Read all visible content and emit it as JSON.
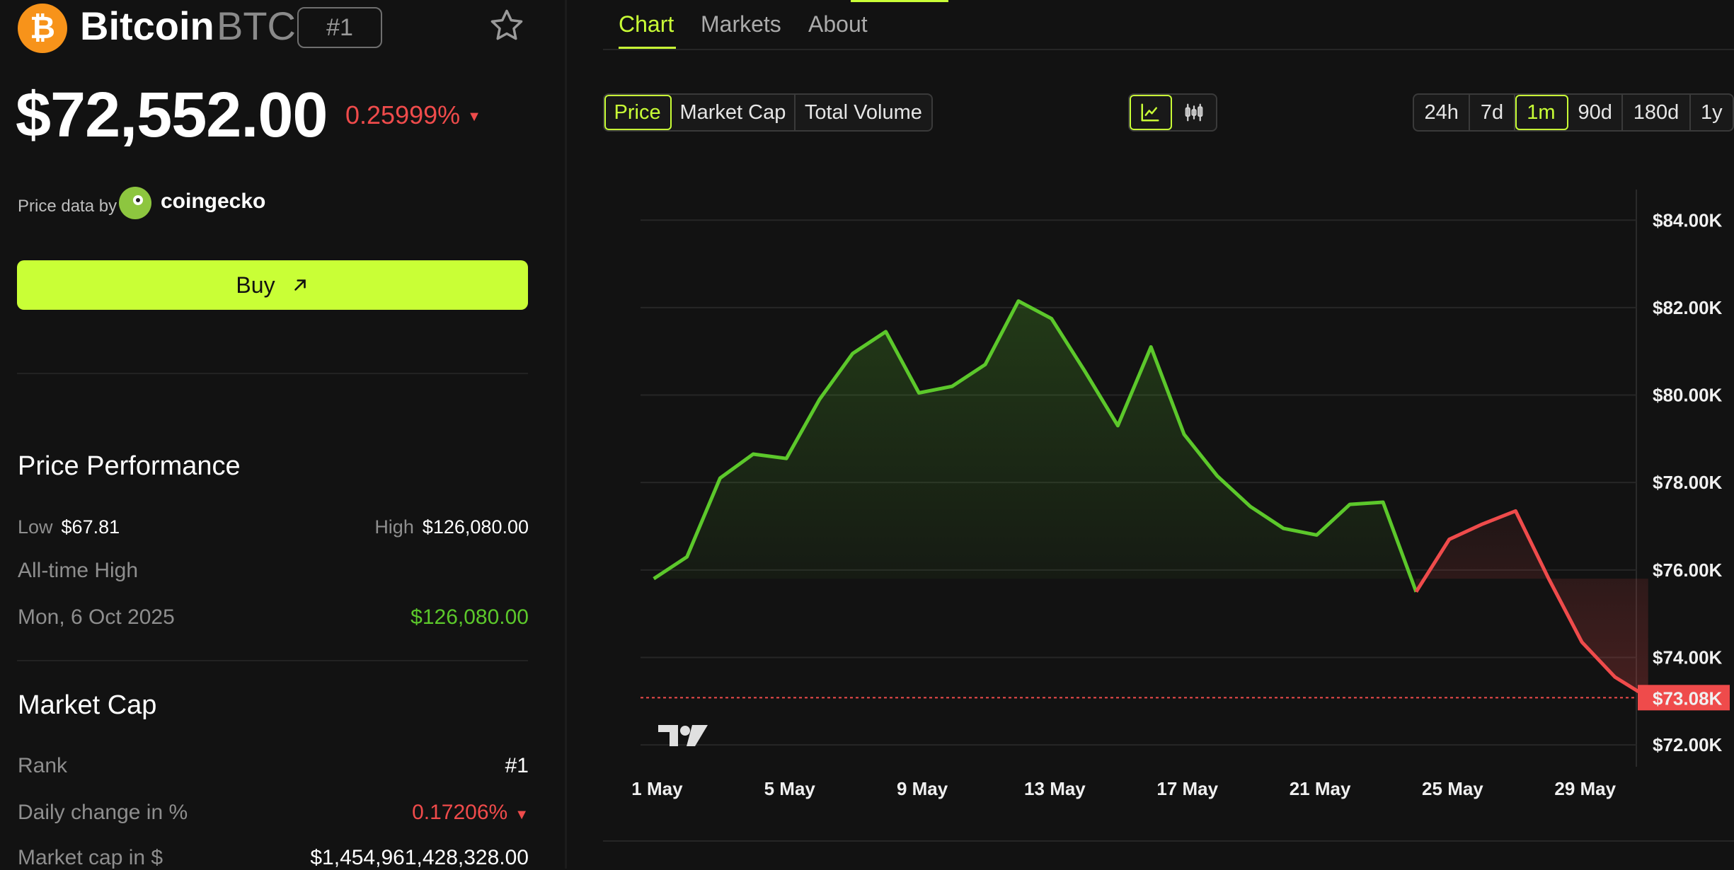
{
  "coin": {
    "logo_glyph": "₿",
    "name": "Bitcoin",
    "symbol": "BTC",
    "rank_badge": "#1",
    "price": "$72,552.00",
    "change_pct": "0.25999%",
    "change_arrow": "▼"
  },
  "source": {
    "label": "Price data by",
    "name": "coingecko"
  },
  "buy_label": "Buy",
  "performance": {
    "title": "Price Performance",
    "low_label": "Low",
    "low_value": "$67.81",
    "high_label": "High",
    "high_value": "$126,080.00",
    "ath_label": "All-time High",
    "ath_date": "Mon, 6 Oct 2025",
    "ath_value": "$126,080.00"
  },
  "market_cap": {
    "title": "Market Cap",
    "rank_label": "Rank",
    "rank_value": "#1",
    "daily_label": "Daily change in %",
    "daily_value": "0.17206%",
    "daily_arrow": "▼",
    "cap_label": "Market cap in $",
    "cap_value": "$1,454,961,428,328.00"
  },
  "tabs": [
    "Chart",
    "Markets",
    "About"
  ],
  "metric_options": [
    "Price",
    "Market Cap",
    "Total Volume"
  ],
  "range_options": [
    "24h",
    "7d",
    "1m",
    "90d",
    "180d",
    "1y"
  ],
  "colors": {
    "accent": "#c9ff36",
    "up": "#5cc82b",
    "down": "#ef4b4b",
    "bitcoin": "#f7931a"
  },
  "chart_data": {
    "type": "area",
    "ylim": [
      71500,
      84700
    ],
    "y_ticks": [
      72000,
      74000,
      76000,
      78000,
      80000,
      82000,
      84000
    ],
    "y_tick_labels": [
      "$72.00K",
      "$74.00K",
      "$76.00K",
      "$78.00K",
      "$80.00K",
      "$82.00K",
      "$84.00K"
    ],
    "x_tick_labels": [
      "1 May",
      "5 May",
      "9 May",
      "13 May",
      "17 May",
      "21 May",
      "25 May",
      "29 May"
    ],
    "x_tick_days": [
      1,
      5,
      9,
      13,
      17,
      21,
      25,
      29
    ],
    "x_range": [
      0.5,
      30.5
    ],
    "baseline": 75800,
    "current_price": 73080,
    "current_label": "$73.08K",
    "series": [
      {
        "points": [
          [
            0.9,
            75800
          ],
          [
            1.9,
            76300
          ],
          [
            2.9,
            78100
          ],
          [
            3.9,
            78650
          ],
          [
            4.9,
            78550
          ],
          [
            5.9,
            79900
          ],
          [
            6.9,
            80950
          ],
          [
            7.9,
            81450
          ],
          [
            8.9,
            80050
          ],
          [
            9.9,
            80200
          ],
          [
            10.9,
            80700
          ],
          [
            11.9,
            82150
          ],
          [
            12.9,
            81750
          ],
          [
            13.9,
            80550
          ],
          [
            14.9,
            79300
          ],
          [
            15.9,
            81100
          ],
          [
            16.9,
            79100
          ],
          [
            17.9,
            78150
          ],
          [
            18.9,
            77450
          ],
          [
            19.9,
            76950
          ],
          [
            20.9,
            76800
          ],
          [
            21.9,
            77500
          ],
          [
            22.9,
            77550
          ],
          [
            23.9,
            75500
          ],
          [
            24.9,
            76700
          ],
          [
            25.9,
            77050
          ],
          [
            26.9,
            77350
          ],
          [
            27.9,
            75800
          ],
          [
            28.9,
            74350
          ],
          [
            29.9,
            73550
          ],
          [
            30.9,
            73080
          ]
        ]
      }
    ]
  }
}
